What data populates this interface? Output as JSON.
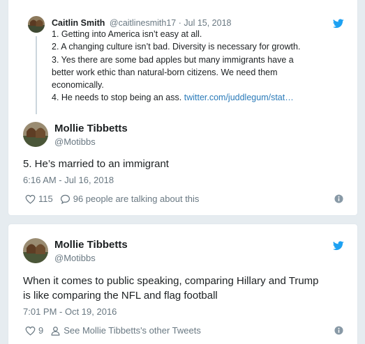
{
  "colors": {
    "accent": "#1da1f2",
    "link": "#2b7bb9",
    "muted": "#697882",
    "text": "#1c2022",
    "background": "#e6ecf0"
  },
  "quoted": {
    "name": "Caitlin Smith",
    "handle": "@caitlinesmith17",
    "separator": " · ",
    "date": "Jul 15, 2018",
    "lines": [
      "1. Getting into America isn’t easy at all.",
      "2. A changing culture isn’t bad. Diversity is necessary for growth.",
      "3. Yes there are some bad apples but  many immigrants have a",
      "better work ethic than natural-born citizens. We need them",
      "economically.",
      "4. He needs to stop being an ass. "
    ],
    "link": "twitter.com/juddlegum/stat…"
  },
  "tweet1": {
    "name": "Mollie Tibbetts",
    "handle": "@Motibbs",
    "text": "5. He’s married to an immigrant",
    "time": "6:16 AM - Jul 16, 2018",
    "likes": "115",
    "talking": "96 people are talking about this",
    "icons": [
      "twitter-bird-icon",
      "heart-icon",
      "speech-bubble-icon",
      "info-icon"
    ]
  },
  "tweet2": {
    "name": "Mollie Tibbetts",
    "handle": "@Motibbs",
    "text_lines": [
      "When it comes to public speaking, comparing Hillary and Trump",
      "is like comparing the NFL and flag football"
    ],
    "time": "7:01 PM - Oct 19, 2016",
    "likes": "9",
    "other_tweets": "See Mollie Tibbetts's other Tweets",
    "icons": [
      "twitter-bird-icon",
      "heart-icon",
      "person-icon",
      "info-icon"
    ]
  }
}
